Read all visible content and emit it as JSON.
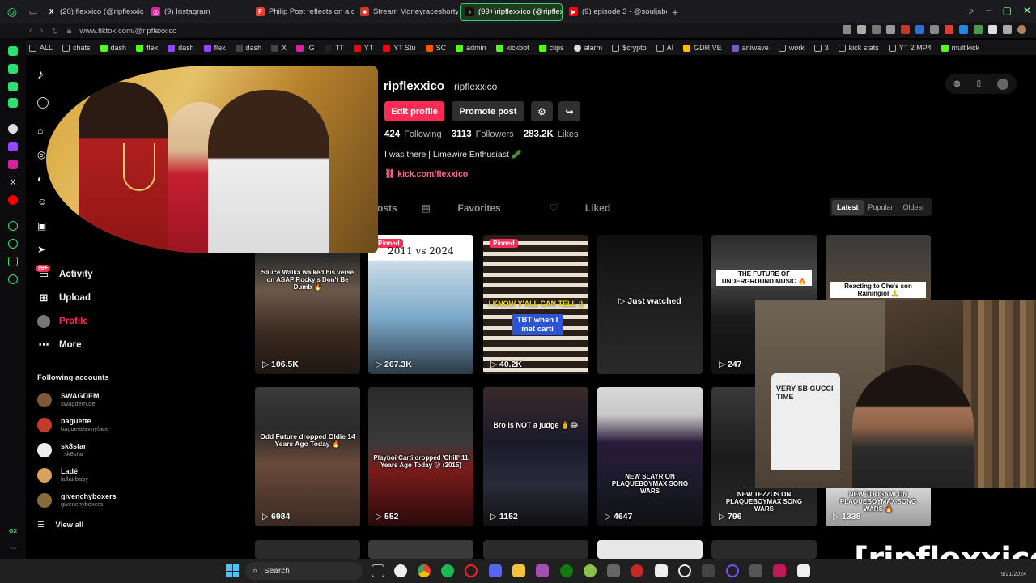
{
  "browser": {
    "tabs": [
      {
        "label": "(20) flexxico (@ripflexxic",
        "color": "#1d1d1d",
        "glyph": "X"
      },
      {
        "label": "(9) Instagram",
        "color": "#d6249f",
        "glyph": "◎"
      },
      {
        "label": "Philip Post reflects on a d",
        "color": "#ef3b2c",
        "glyph": "F"
      },
      {
        "label": "Stream Moneyraceshorty",
        "color": "#e1301f",
        "glyph": "■"
      },
      {
        "label": "(99+)ripflexxico (@ripflex",
        "color": "#111111",
        "glyph": "♪",
        "active": true
      },
      {
        "label": "(9) episode 3 - @souljabo",
        "color": "#ff0000",
        "glyph": "▶"
      }
    ],
    "new_tab": "+",
    "url": "www.tiktok.com/@ripflexxico",
    "bookmarks": [
      "ALL",
      "chats",
      "dash",
      "flex",
      "dash",
      "flex",
      "dash",
      "X",
      "IG",
      "TT",
      "YT",
      "YT Stu",
      "SC",
      "admin",
      "kickbot",
      "clips",
      "alarm",
      "$crypto",
      "AI",
      "GDRIVE",
      "aniwave",
      "work",
      "3",
      "kick stats",
      "YT 2 MP4",
      "multikick"
    ]
  },
  "nav": {
    "items": [
      {
        "label": "Activity",
        "icon": "inbox-icon"
      },
      {
        "label": "Upload",
        "icon": "upload-icon"
      },
      {
        "label": "Profile",
        "icon": "avatar-icon",
        "active": true
      },
      {
        "label": "More",
        "icon": "more-icon"
      }
    ],
    "activity_badge": "99+",
    "following_title": "Following accounts",
    "accounts": [
      {
        "name": "SWAGDEM",
        "handle": "swagdem.de",
        "color": "#7a5a3a"
      },
      {
        "name": "baguette",
        "handle": "baguetteinmyface",
        "color": "#c23b2b"
      },
      {
        "name": "sk8star",
        "handle": "_sk8star",
        "color": "#eeeeee"
      },
      {
        "name": "Ladé",
        "handle": "laflairbaby",
        "color": "#d8a25a"
      },
      {
        "name": "givenchyboxers",
        "handle": "givenchyboxers",
        "color": "#8a6a3a"
      }
    ],
    "view_all": "View all"
  },
  "profile": {
    "username": "ripflexxico",
    "handle": "ripflexxico",
    "edit_label": "Edit profile",
    "promote_label": "Promote post",
    "following_count": "424",
    "following_label": "Following",
    "followers_count": "3113",
    "followers_label": "Followers",
    "likes_count": "283.2K",
    "likes_label": "Likes",
    "bio": "I was there | Limewire Enthusiast 🥒",
    "link": "kick.com/flexxico"
  },
  "tabs": {
    "posts": "osts",
    "favorites": "Favorites",
    "liked": "Liked"
  },
  "sort": {
    "latest": "Latest",
    "popular": "Popular",
    "oldest": "Oldest"
  },
  "videos": [
    {
      "views": "106.5K",
      "caption": "Sauce Walka walked his verse on ASAP Rocky's Don't Be Dumb 🔥"
    },
    {
      "views": "267.3K",
      "caption": "2011 vs 2024",
      "pinned": "Pinned"
    },
    {
      "views": "40.2K",
      "caption": "I KNOW Y'ALL CAN TELL :)",
      "caption2": "TBT when I met carti",
      "pinned": "Pinned"
    },
    {
      "views": "",
      "caption": "Just watched"
    },
    {
      "views": "247",
      "caption": "THE FUTURE OF UNDERGROUND MUSIC 🔥"
    },
    {
      "views": "",
      "caption": "Reacting to Che's son Rainingiol 🙏"
    },
    {
      "views": "6984",
      "caption": "Odd Future dropped Oldie 14 Years Ago Today 🔥"
    },
    {
      "views": "552",
      "caption": "Playboi Carti dropped 'Chill' 11 Years Ago Today 😮 (2015)"
    },
    {
      "views": "1152",
      "caption": "Bro is NOT a judge ✌️😂"
    },
    {
      "views": "4647",
      "caption": "NEW SLAYR ON PLAQUEBOYMAX SONG WARS"
    },
    {
      "views": "796",
      "caption": "NEW TEZZUS ON PLAQUEBOYMAX SONG WARS"
    },
    {
      "views": "1338",
      "caption": "NEW TOOSAMI ON PLAQUEBOYMAX SONG WARS 🔥"
    }
  ],
  "overlay": {
    "shirt_text": "VERY SB GUCCI TIME",
    "watermark": "[ripflexxico]"
  },
  "taskbar": {
    "search": "Search",
    "date": "9/21/2024"
  },
  "colors": {
    "accent": "#fe2c55",
    "opera_green": "#2ee06f"
  }
}
